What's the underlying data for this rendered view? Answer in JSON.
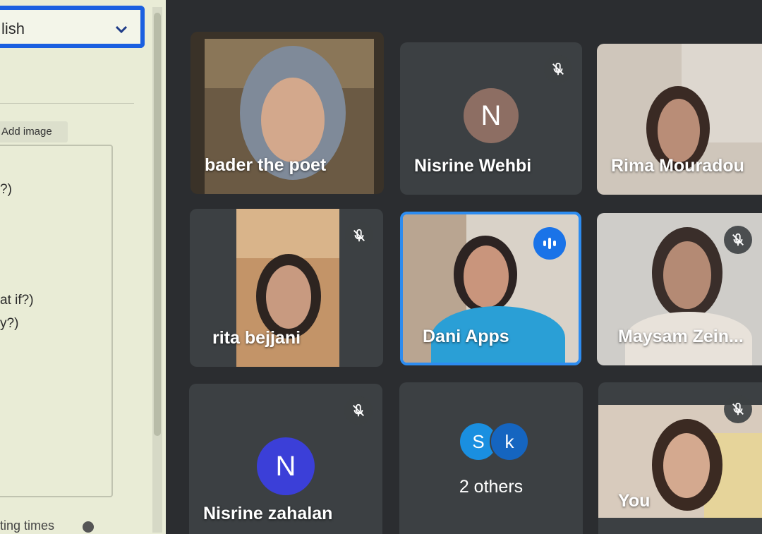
{
  "left_panel": {
    "language_value": "lish",
    "add_image_label": "Add image",
    "text_fragments": [
      "?)",
      "at if?)",
      "y?)"
    ],
    "footer_text": "ting times"
  },
  "participants": [
    {
      "name": "bader the poet",
      "muted": false,
      "video": true
    },
    {
      "name": "Nisrine Wehbi",
      "muted": true,
      "video": false,
      "avatar_letter": "N",
      "avatar_color": "#8d6e63"
    },
    {
      "name": "Rima Mouradou",
      "muted": false,
      "video": true
    },
    {
      "name": "rita bejjani",
      "muted": true,
      "video": true
    },
    {
      "name": "Dani Apps",
      "muted": false,
      "video": true,
      "speaking": true
    },
    {
      "name": "Maysam Zein...",
      "muted": true,
      "video": true
    },
    {
      "name": "Nisrine zahalan",
      "muted": true,
      "video": false,
      "avatar_letter": "N",
      "avatar_color": "#3b3fd8"
    },
    {
      "name": "2 others",
      "others_letters": [
        "S",
        "k"
      ]
    },
    {
      "name": "You",
      "muted": true,
      "video": true
    }
  ],
  "colors": {
    "accent": "#1a73e8",
    "tile_bg": "#3c4043",
    "selection_border": "#1a5fe0"
  },
  "icons": [
    "chevron-down-icon",
    "mic-off-icon",
    "audio-wave-icon"
  ]
}
